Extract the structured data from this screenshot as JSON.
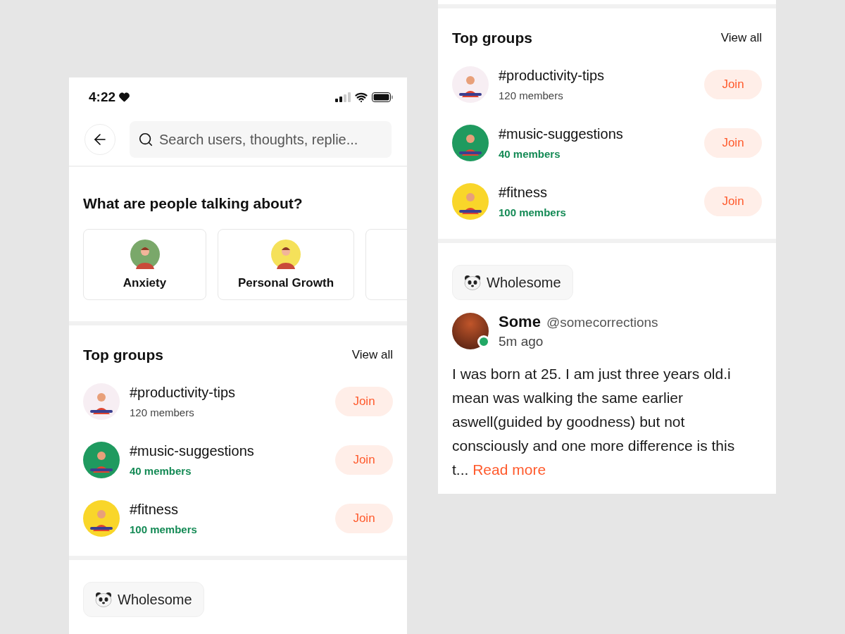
{
  "screens": [
    {
      "status_bar": {
        "time": "4:22"
      },
      "search": {
        "placeholder": "Search users, thoughts, replie..."
      },
      "topics": {
        "title": "What are people talking about?",
        "items": [
          {
            "kind": "topic",
            "label": "Anxiety",
            "color": "#7aa86a"
          },
          {
            "kind": "topic",
            "label": "Personal Growth",
            "color": "#f5e15a"
          },
          {
            "kind": "clipped"
          }
        ]
      },
      "top_groups": {
        "title": "Top groups",
        "view_all": "View all",
        "items": [
          {
            "name": "#productivity-tips",
            "members": "120 members",
            "highlighted": false,
            "color": "#f7eef3",
            "button": "Join"
          },
          {
            "name": "#music-suggestions",
            "members": "40 members",
            "highlighted": true,
            "color": "#1f9a5f",
            "button": "Join"
          },
          {
            "name": "#fitness",
            "members": "100 members",
            "highlighted": true,
            "color": "#f9d62a",
            "button": "Join"
          }
        ]
      },
      "tag": {
        "label": "Wholesome"
      }
    },
    {
      "top_groups": {
        "title": "Top groups",
        "view_all": "View all",
        "items": [
          {
            "name": "#productivity-tips",
            "members": "120 members",
            "highlighted": false,
            "color": "#f7eef3",
            "button": "Join"
          },
          {
            "name": "#music-suggestions",
            "members": "40 members",
            "highlighted": true,
            "color": "#1f9a5f",
            "button": "Join"
          },
          {
            "name": "#fitness",
            "members": "100 members",
            "highlighted": true,
            "color": "#f9d62a",
            "button": "Join"
          }
        ]
      },
      "tag": {
        "label": "Wholesome"
      },
      "post": {
        "author": "Some",
        "handle": "@somecorrections",
        "time": "5m ago",
        "online": true,
        "text": "I was born at 25. I am just three years old.i mean was walking the same earlier aswell(guided by goodness) but not consciously and one more difference is this t...",
        "read_more": "Read more"
      }
    }
  ]
}
